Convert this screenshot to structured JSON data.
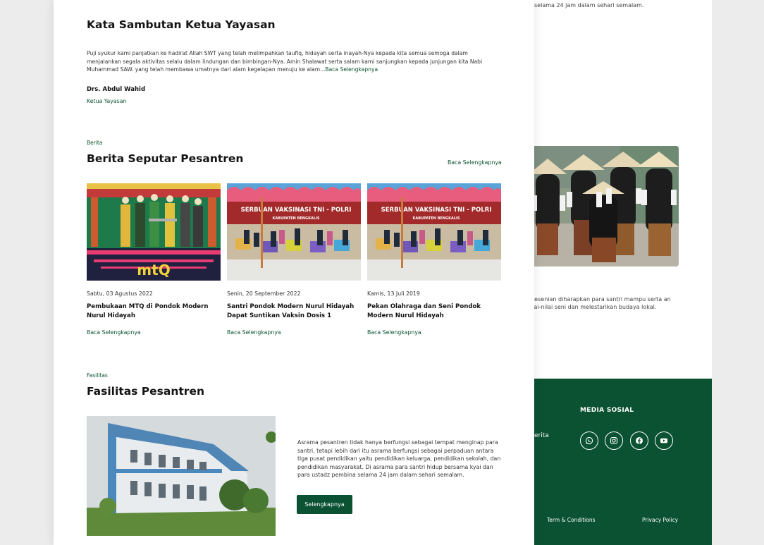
{
  "background_page": {
    "top_text": "selama 24 jam dalam sehari semalam.",
    "caption": "r kesenian diharapkan para santri mampu serta an nilai-nilai seni dan melestarikan budaya lokal.",
    "footer": {
      "fragment_text": "erita",
      "media_sosial_title": "MEDIA SOSIAL",
      "social_icons": [
        "whatsapp-icon",
        "instagram-icon",
        "facebook-icon",
        "youtube-icon"
      ],
      "terms_link": "Term & Conditions",
      "privacy_link": "Privacy Policy",
      "bg_color": "#0a5231"
    }
  },
  "welcome": {
    "title": "Kata Sambutan Ketua Yayasan",
    "paragraph": "Puji syukur kami panjatkan ke hadirat Allah SWT yang telah melimpahkan taufiq, hidayah serta inayah-Nya kepada kita semua semoga dalam menjalankan segala aktivitas selalu dalam lindungan dan bimbingan-Nya. Amin Shalawat serta salam kami sanjungkan kepada junjungan kita Nabi Muhammad SAW. yang telah membawa umatnya dari alam kegelapan menuju ke alam...",
    "read_more": "Baca Selengkapnya",
    "signer_name": "Drs. Abdul Wahid",
    "signer_role": "Ketua Yayasan"
  },
  "news": {
    "tag": "Berita",
    "title": "Berita Seputar Pesantren",
    "read_more": "Baca Selengkapnya",
    "items": [
      {
        "date": "Sabtu, 03 Agustus 2022",
        "title": "Pembukaan MTQ di Pondok Modern Nurul Hidayah",
        "link": "Baca Selengkapnya"
      },
      {
        "date": "Senin, 20 September 2022",
        "title": "Santri Pondok Modern Nurul Hidayah Dapat Suntikan Vaksin Dosis 1",
        "link": "Baca Selengkapnya",
        "banner": "SERBUAN VAKSINASI TNI - POLRI",
        "sub_banner": "KABUPATEN BENGKALIS"
      },
      {
        "date": "Kamis, 13 Juli 2019",
        "title": "Pekan Olahraga dan Seni Pondok Modern Nurul Hidayah",
        "link": "Baca Selengkapnya",
        "banner": "SERBUAN VAKSINASI TNI - POLRI",
        "sub_banner": "KABUPATEN BENGKALIS"
      }
    ],
    "mtq_logo_text": "mtQ"
  },
  "facilities": {
    "tag": "Fasilitas",
    "title": "Fasilitas Pesantren",
    "description": "Asrama pesantren tidak hanya berfungsi sebagai tempat menginap para santri, tetapi lebih dari itu asrama berfungsi sebagai perpaduan antara tiga pusat pendidikan yaitu pendidikan keluarga, pendidikan sekolah, dan pendidikan masyarakat. Di asrama para santri hidup bersama kyai dan para ustadz pembina selama 24 jam dalam sehari semalam.",
    "button_label": "Selengkapnya"
  },
  "colors": {
    "accent": "#0a5231",
    "page_bg": "#ececec"
  }
}
